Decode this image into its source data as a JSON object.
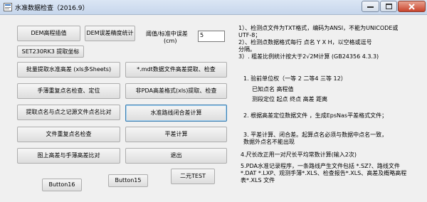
{
  "window": {
    "title": "水准数据检查（2016.9）"
  },
  "threshold": {
    "label_line1": "阈值/标准中误差",
    "label_line2": "(cm)",
    "value": "5"
  },
  "buttons": {
    "dem_interp": "DEM高程插值",
    "dem_accuracy": "DEM误差精度统计",
    "set230rk3": "SET230RK3 提取坐标",
    "batch_extract": "批量提取水准高差 (xls多Sheets)",
    "mdt_extract": "*.mdt数据文件高差提取、检查",
    "manual_point_check": "手薄重复点名检查、定位",
    "non_pda_check": "非PDA高差格式(xls)提取、检查",
    "extract_compare": "提取点名与点之记源文件点名比对",
    "closure_calc": "水准路线闭合差计算",
    "file_repeat_check": "文件重复点名检查",
    "adjustment": "平差计算",
    "map_vs_manual": "图上高差与手薄高差比对",
    "exit": "退出",
    "button16": "Button16",
    "button15": "Button15",
    "binary_test": "二元TEST"
  },
  "notes": {
    "n1_l1": "1）、检测点文件为TXT格式，编码为ANSI，不能为UNICODE或",
    "n1_l2": "UTF-8；",
    "n2_l1": "2）、检测点数据格式每行   点名   Y   X   H，以空格或逗号",
    "n2_l2": "分隔。",
    "n3": "3）. 粗差比例统计按大于2√2M计算 (GB24356 4.3.3)",
    "s1": "1. 验前单位权（一等 2    二等4  三等    12）",
    "s1a": "已知点名   高程值",
    "s1b": "测段定位   起点   终点   高差   距离",
    "s2": "2. 根据高差定位数据文件  ，生成EpsNas平差格式文件；",
    "s3_l1": "3. 平差计算、闭合差。起算点名必须与数据中点名一致，",
    "s3_l2": "数据外点名不能出现",
    "s4": "4.尺长改正用一对尺长平均常数计算(输入2次)",
    "s5_l1": "5.PDA水准记录程序，一条路线产生文件包括 *.SZ?、路线文件",
    "s5_l2": "*.DAT *.LXP、观测手薄*.XLS、检查报告*.XLS、高差及概略高程",
    "s5_l3": "表*.XLS  文件"
  },
  "icons": {
    "app": "app-icon",
    "minimize": "minimize-icon",
    "maximize": "maximize-icon",
    "close": "close-icon"
  }
}
